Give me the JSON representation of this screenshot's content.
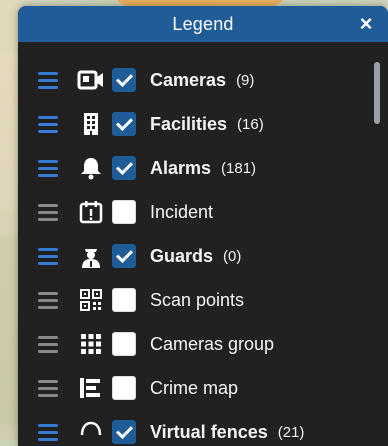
{
  "legend": {
    "title": "Legend",
    "close_label": "×",
    "items": [
      {
        "label": "Cameras",
        "count": "(9)",
        "checked": true,
        "bold": true,
        "drag_color": "#3b7bd6",
        "icon": "camera-icon"
      },
      {
        "label": "Facilities",
        "count": "(16)",
        "checked": true,
        "bold": true,
        "drag_color": "#3b7bd6",
        "icon": "building-icon"
      },
      {
        "label": "Alarms",
        "count": "(181)",
        "checked": true,
        "bold": true,
        "drag_color": "#3b7bd6",
        "icon": "bell-icon"
      },
      {
        "label": "Incident",
        "count": "",
        "checked": false,
        "bold": false,
        "drag_color": "#8a8a8a",
        "icon": "calendar-alert-icon"
      },
      {
        "label": "Guards",
        "count": "(0)",
        "checked": true,
        "bold": true,
        "drag_color": "#3b7bd6",
        "icon": "guard-icon"
      },
      {
        "label": "Scan points",
        "count": "",
        "checked": false,
        "bold": false,
        "drag_color": "#8a8a8a",
        "icon": "qr-code-icon"
      },
      {
        "label": "Cameras group",
        "count": "",
        "checked": false,
        "bold": false,
        "drag_color": "#8a8a8a",
        "icon": "grid-icon"
      },
      {
        "label": "Crime map",
        "count": "",
        "checked": false,
        "bold": false,
        "drag_color": "#8a8a8a",
        "icon": "crime-map-icon"
      },
      {
        "label": "Virtual fences",
        "count": "(21)",
        "checked": true,
        "bold": true,
        "drag_color": "#3b7bd6",
        "icon": "fence-icon"
      }
    ]
  },
  "colors": {
    "header_bg": "#1f5c98",
    "panel_bg": "#212121",
    "checked_bg": "#1f5c98"
  }
}
